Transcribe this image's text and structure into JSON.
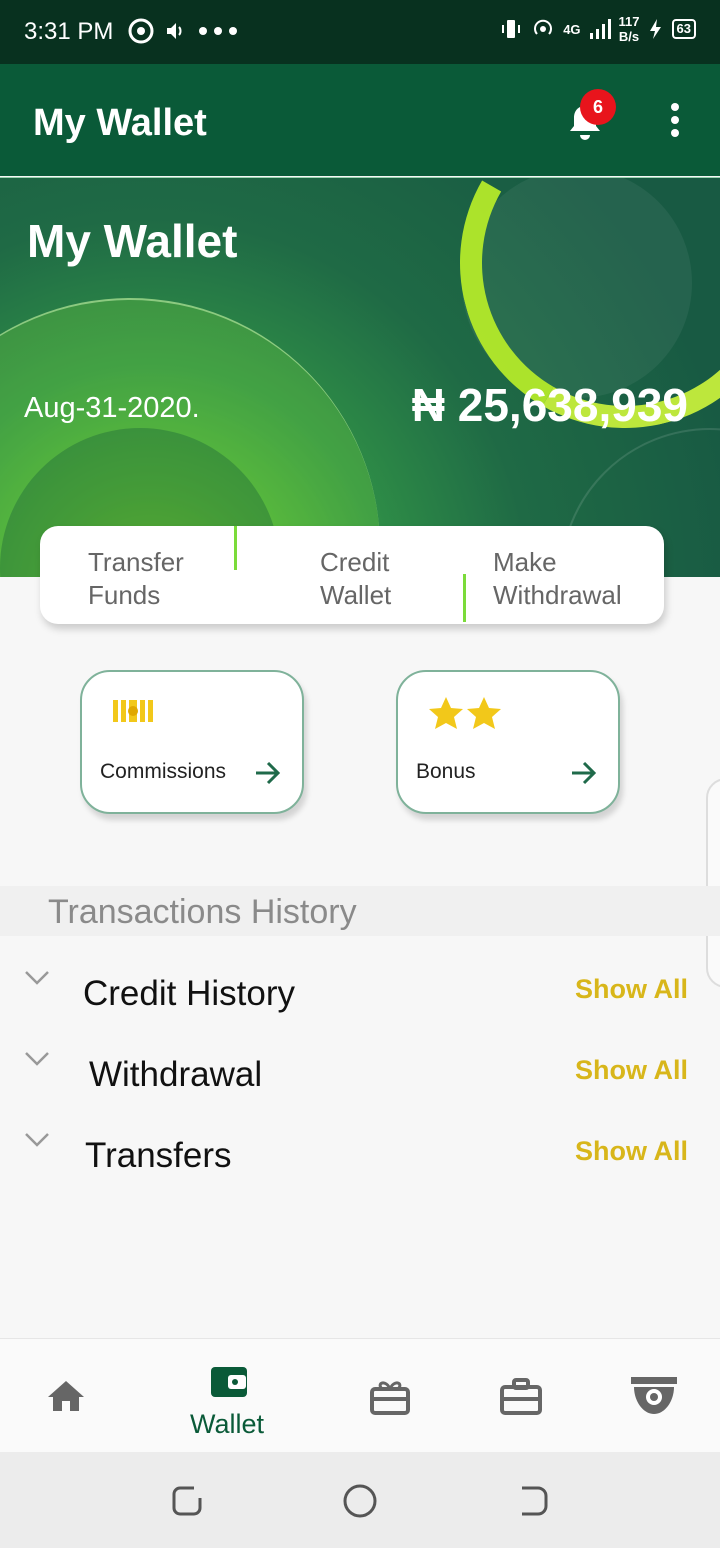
{
  "status_bar": {
    "time": "3:31 PM",
    "network": "4G",
    "rate_value": "117",
    "rate_unit": "B/s",
    "battery": "63"
  },
  "app_bar": {
    "title": "My Wallet",
    "notification_count": "6",
    "icons": [
      "bell-icon",
      "more-vert-icon"
    ]
  },
  "wallet": {
    "heading": "My Wallet",
    "date": "Aug-31-2020.",
    "balance": "₦ 25,638,939"
  },
  "actions": [
    {
      "line1": "Transfer",
      "line2": "Funds"
    },
    {
      "line1": "Credit",
      "line2": "Wallet"
    },
    {
      "line1": "Make",
      "line2": "Withdrawal"
    }
  ],
  "tiles": [
    {
      "label": "Commissions",
      "icon": "cash-icon"
    },
    {
      "label": "Bonus",
      "icon": "stars-icon"
    }
  ],
  "transactions": {
    "title": "Transactions History",
    "rows": [
      {
        "label": "Credit History",
        "action": "Show All"
      },
      {
        "label": "Withdrawal",
        "action": "Show All"
      },
      {
        "label": "Transfers",
        "action": "Show All"
      }
    ]
  },
  "bottom_nav": {
    "items": [
      "home-icon",
      "wallet-icon",
      "gift-icon",
      "briefcase-icon",
      "cctv-icon"
    ],
    "active_label": "Wallet"
  },
  "colors": {
    "primary": "#0a5a38",
    "accent": "#d8b61a",
    "badge": "#e8141c"
  }
}
